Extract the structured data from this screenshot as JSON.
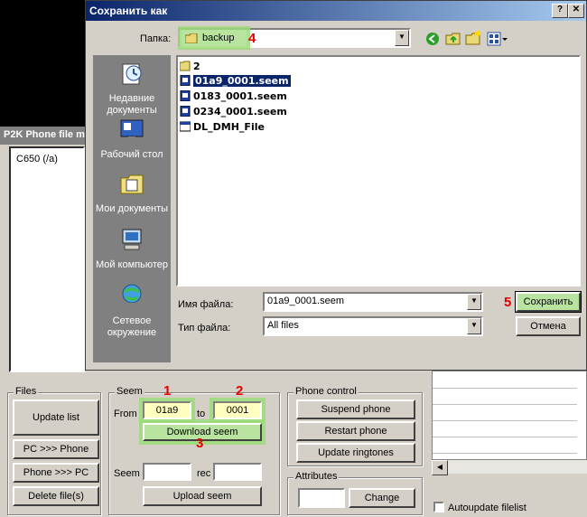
{
  "p2k": {
    "title": "P2K Phone file m",
    "phone_list": [
      "C650 (/a)"
    ],
    "files_group": {
      "title": "Files",
      "update_list": "Update list",
      "pc_to_phone": "PC >>> Phone",
      "phone_to_pc": "Phone >>> PC",
      "delete_files": "Delete file(s)"
    },
    "seem_group": {
      "title": "Seem",
      "from_label": "From",
      "from_value": "01a9",
      "to_label": "to",
      "to_value": "0001",
      "download": "Download seem",
      "seem_label": "Seem",
      "seem_value": "",
      "rec_label": "rec",
      "rec_value": "",
      "upload": "Upload seem"
    },
    "phone_control": {
      "title": "Phone control",
      "suspend": "Suspend phone",
      "restart": "Restart phone",
      "update_ringtones": "Update ringtones"
    },
    "attributes": {
      "title": "Attributes",
      "value": "",
      "change": "Change"
    },
    "autoupdate_label": "Autoupdate filelist"
  },
  "dialog": {
    "title": "Сохранить как",
    "folder_label": "Папка:",
    "folder_value": "backup",
    "places": [
      {
        "icon": "recent-documents-icon",
        "label": "Недавние документы"
      },
      {
        "icon": "desktop-icon",
        "label": "Рабочий стол"
      },
      {
        "icon": "my-documents-icon",
        "label": "Мои документы"
      },
      {
        "icon": "my-computer-icon",
        "label": "Мой компьютер"
      },
      {
        "icon": "network-icon",
        "label": "Сетевое окружение"
      }
    ],
    "files": [
      {
        "name": "2",
        "type": "folder"
      },
      {
        "name": "01a9_0001.seem",
        "type": "file",
        "selected": true
      },
      {
        "name": "0183_0001.seem",
        "type": "file"
      },
      {
        "name": "0234_0001.seem",
        "type": "file"
      },
      {
        "name": "DL_DMH_File",
        "type": "app"
      }
    ],
    "filename_label": "Имя файла:",
    "filename_value": "01a9_0001.seem",
    "filetype_label": "Тип файла:",
    "filetype_value": "All files",
    "save_button": "Сохранить",
    "cancel_button": "Отмена"
  },
  "markers": {
    "m1": "1",
    "m2": "2",
    "m3": "3",
    "m4": "4",
    "m5": "5"
  },
  "colors": {
    "highlight": "#9cdc78",
    "marker": "#e00000",
    "title_bar": "#0a246a"
  }
}
